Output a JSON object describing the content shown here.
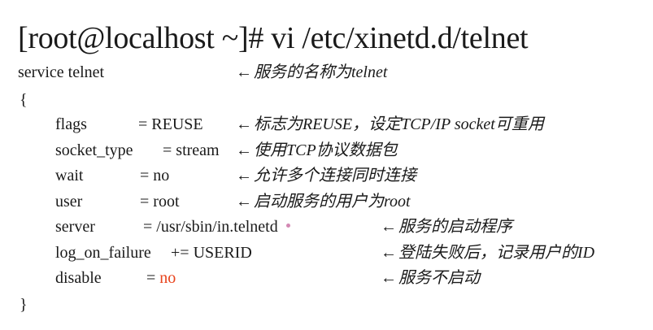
{
  "title": "[root@localhost ~]# vi /etc/xinetd.d/telnet",
  "service_line": "service telnet",
  "brace_open": "{",
  "brace_close": "}",
  "arrow": "←",
  "service_anno": "服务的名称为telnet",
  "entries": [
    {
      "key": "flags",
      "op": "=",
      "value": "REUSE",
      "anno": "标志为REUSE，设定TCP/IP socket可重用"
    },
    {
      "key": "socket_type",
      "op": "=",
      "value": "stream",
      "anno": "使用TCP协议数据包"
    },
    {
      "key": "wait",
      "op": "=",
      "value": "no",
      "anno": "允许多个连接同时连接"
    },
    {
      "key": "user",
      "op": "=",
      "value": "root",
      "anno": "启动服务的用户为root"
    },
    {
      "key": "server",
      "op": "=",
      "value": "/usr/sbin/in.telnetd",
      "anno": "服务的启动程序"
    },
    {
      "key": "log_on_failure",
      "op": "+=",
      "value": "USERID",
      "anno": "登陆失败后，记录用户的ID"
    },
    {
      "key": "disable",
      "op": "=",
      "value": "no",
      "anno": "服务不启动"
    }
  ],
  "colors": {
    "highlight": "#e8431c"
  }
}
